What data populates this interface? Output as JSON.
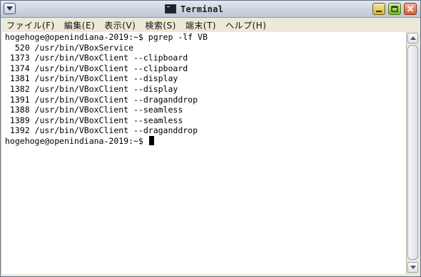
{
  "window": {
    "title": "Terminal"
  },
  "menubar": {
    "items": [
      {
        "label": "ファイル(F)"
      },
      {
        "label": "編集(E)"
      },
      {
        "label": "表示(V)"
      },
      {
        "label": "検索(S)"
      },
      {
        "label": "端末(T)"
      },
      {
        "label": "ヘルプ(H)"
      }
    ]
  },
  "terminal": {
    "lines": [
      "hogehoge@openindiana-2019:~$ pgrep -lf VB",
      "  520 /usr/bin/VBoxService",
      " 1373 /usr/bin/VBoxClient --clipboard",
      " 1374 /usr/bin/VBoxClient --clipboard",
      " 1381 /usr/bin/VBoxClient --display",
      " 1382 /usr/bin/VBoxClient --display",
      " 1391 /usr/bin/VBoxClient --draganddrop",
      " 1388 /usr/bin/VBoxClient --seamless",
      " 1389 /usr/bin/VBoxClient --seamless",
      " 1392 /usr/bin/VBoxClient --draganddrop"
    ],
    "prompt": "hogehoge@openindiana-2019:~$ "
  },
  "colors": {
    "terminal_bg": "#ffffff",
    "terminal_fg": "#000000"
  }
}
